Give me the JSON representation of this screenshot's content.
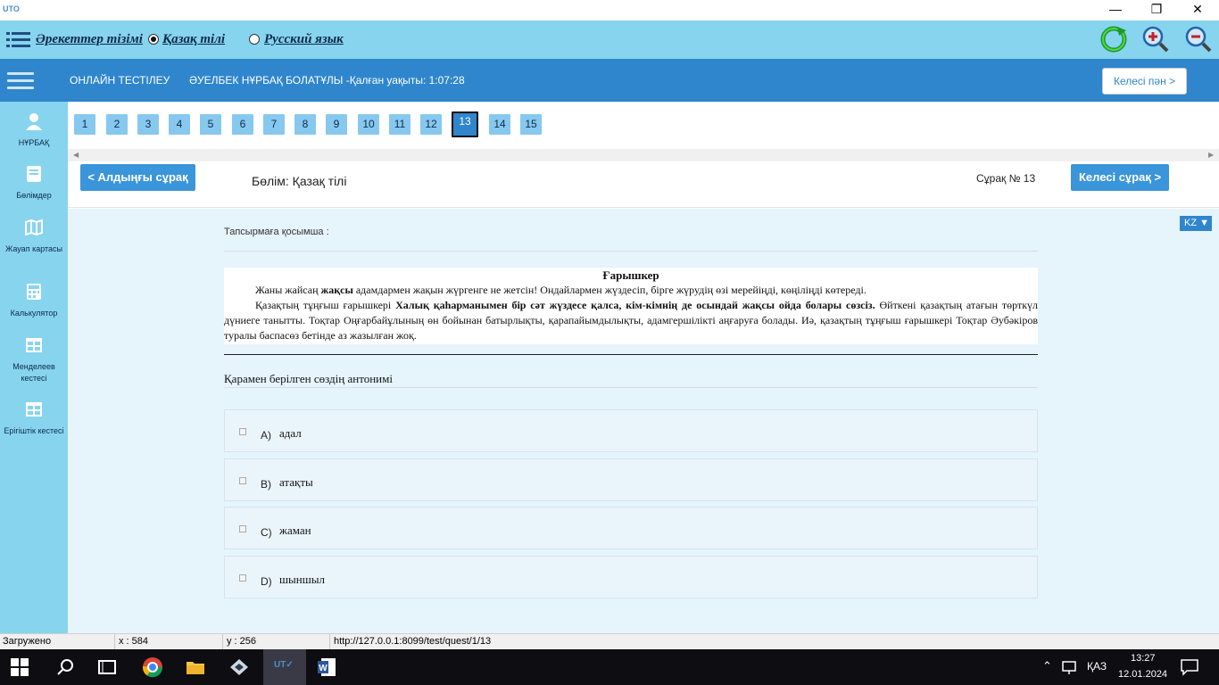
{
  "window": {
    "logo": "UTO",
    "minimize_glyph": "—",
    "restore_glyph": "❐",
    "close_glyph": "✕"
  },
  "toolbar": {
    "actions_list": "Әрекеттер тізімі",
    "lang_kazakh": "Қазақ тілі",
    "lang_russian": "Русский язык",
    "selected_lang": "Қазақ тілі",
    "icons": [
      "refresh-icon",
      "zoom-in-icon",
      "zoom-out-icon"
    ]
  },
  "header": {
    "section_label": "ОНЛАЙН ТЕСТІЛЕУ",
    "user_info": "ӘУЕЛБЕК НҰРБАҚ БОЛАТҰЛЫ -Қалған уақыты: 1:07:28",
    "next_subject": "Келесі пән >"
  },
  "sidebar": {
    "items": [
      {
        "label": "НҰРБАҚ",
        "icon": "user-icon"
      },
      {
        "label": "Бөлімдер",
        "icon": "book-icon"
      },
      {
        "label": "Жауап картасы",
        "icon": "map-icon"
      },
      {
        "label": "Калькулятор",
        "icon": "calculator-icon"
      },
      {
        "label": "Менделеев кестесі",
        "icon": "table-icon"
      },
      {
        "label": "Ерігіштік кестесі",
        "icon": "table-icon"
      }
    ]
  },
  "question_nav": {
    "numbers": [
      "1",
      "2",
      "3",
      "4",
      "5",
      "6",
      "7",
      "8",
      "9",
      "10",
      "11",
      "12",
      "13",
      "14",
      "15"
    ],
    "active": "13"
  },
  "section_bar": {
    "prev_button": "< Алдыңғы сұрақ",
    "section_title": "Бөлім: Қазақ тілі",
    "question_number": "Сұрақ № 13",
    "next_button": "Келесі сұрақ >"
  },
  "content": {
    "lang_selector": "KZ ▼",
    "appendix_label": "Тапсырмаға қосымша :",
    "passage": {
      "title": "Ғарышкер",
      "para1_start": "Жаны жайсаң ",
      "para1_bold": "жақсы",
      "para1_end": " адамдармен жақын жүргенге не жетсін! Ондайлармен жүздесіп, бірге жүрудің өзі мерейіңді, көңіліңді көтереді.",
      "para2_start": "Қазақтың тұңғыш ғарышкері ",
      "para2_bold": "Халық қаһарманымен бір сәт жүздесе қалса, кім-кімнің де осындай жақсы ойда болары сөзсіз.",
      "para2_end": " Өйткені қазақтың атағын төрткүл дүниеге танытты. Тоқтар Оңғарбайұлының өн бойынан батырлықты, қарапайымдылықты, адамгершілікті аңғаруға болады. Иә, қазақтың тұңғыш ғарышкері Тоқтар Әубәкіров туралы баспасөз бетінде аз жазылған жоқ."
    },
    "question": "Қарамен берілген сөздің антонимі",
    "answers": [
      {
        "letter": "A)",
        "text": "адал"
      },
      {
        "letter": "B)",
        "text": "атақты"
      },
      {
        "letter": "C)",
        "text": "жаман"
      },
      {
        "letter": "D)",
        "text": "шыншыл"
      }
    ]
  },
  "statusbar": {
    "status": "Загружено",
    "x": "x : 584",
    "y": "y : 256",
    "url": "http://127.0.0.1:8099/test/quest/1/13"
  },
  "taskbar": {
    "lang": "ҚАЗ",
    "time": "13:27",
    "date": "12.01.2024"
  }
}
